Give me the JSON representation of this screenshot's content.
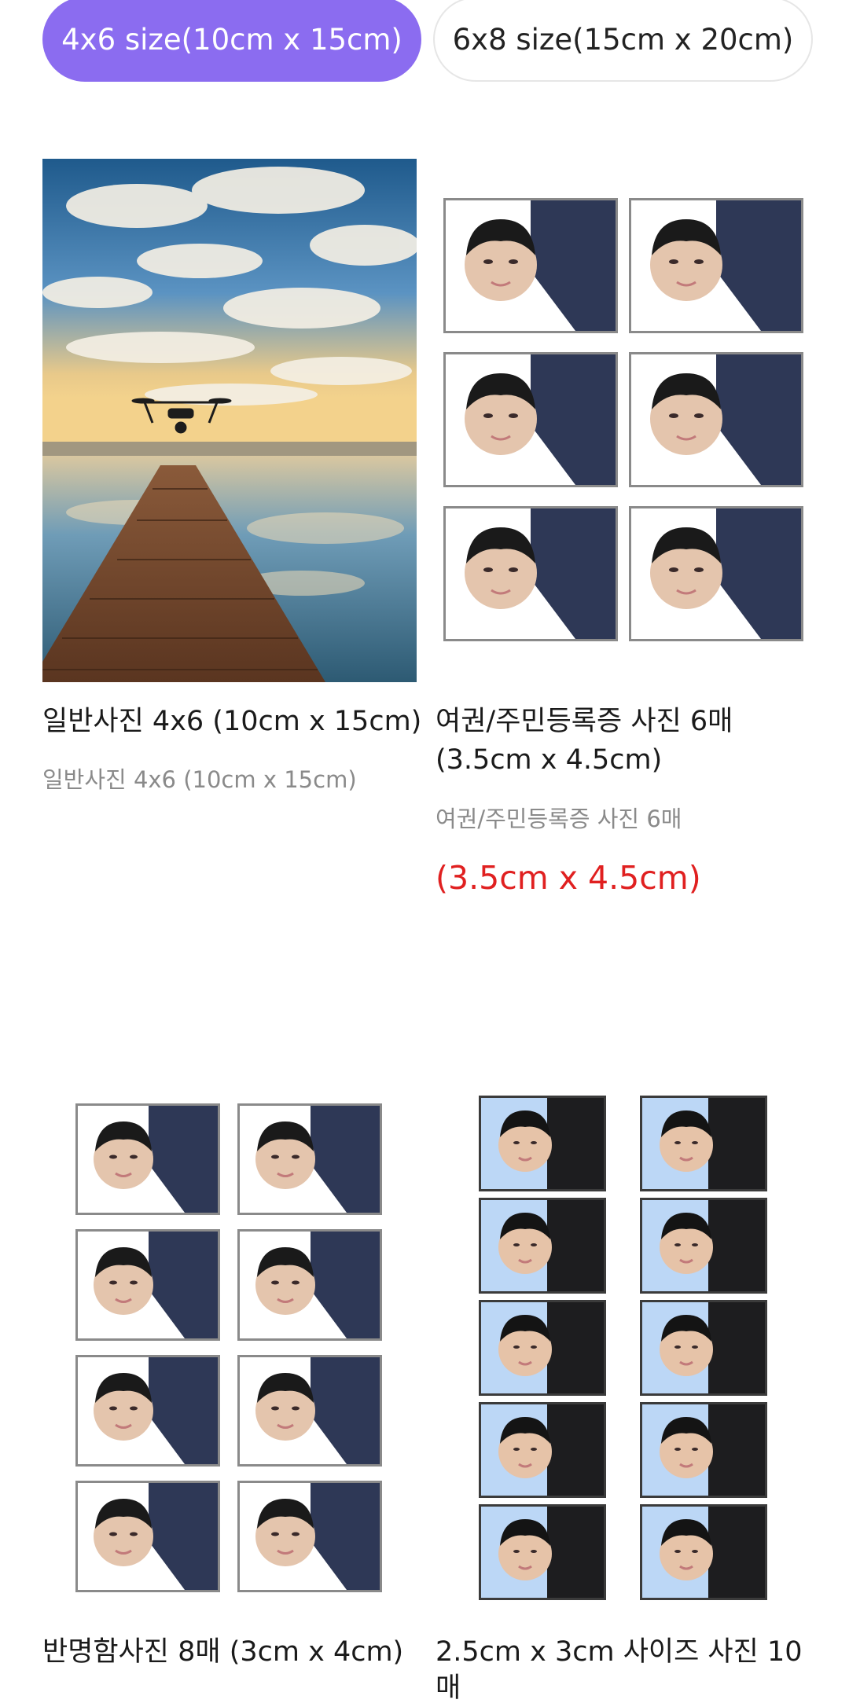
{
  "tabs": [
    {
      "label": "4x6 size(10cm x 15cm)",
      "active": true
    },
    {
      "label": "6x8 size(15cm x 20cm)",
      "active": false
    }
  ],
  "products": [
    {
      "title": "일반사진 4x6 (10cm x 15cm)",
      "subtitle": "일반사진 4x6 (10cm x 15cm)",
      "thumb": "landscape-photo"
    },
    {
      "title_line1": "여권/주민등록증 사진 6매",
      "title_line2": "(3.5cm x 4.5cm)",
      "subtitle": "여권/주민등록증 사진 6매",
      "price": "(3.5cm x 4.5cm)",
      "thumb": "id-photo-grid-6"
    },
    {
      "title": "반명함사진 8매 (3cm x 4cm)",
      "thumb": "id-photo-grid-8"
    },
    {
      "title_line1": "2.5cm x 3cm 사이즈 사진 10",
      "title_line2": "매",
      "thumb": "id-photo-grid-10"
    }
  ],
  "colors": {
    "accent": "#8b6cf0",
    "price": "#e02020",
    "subtitle": "#8a8a8a"
  }
}
